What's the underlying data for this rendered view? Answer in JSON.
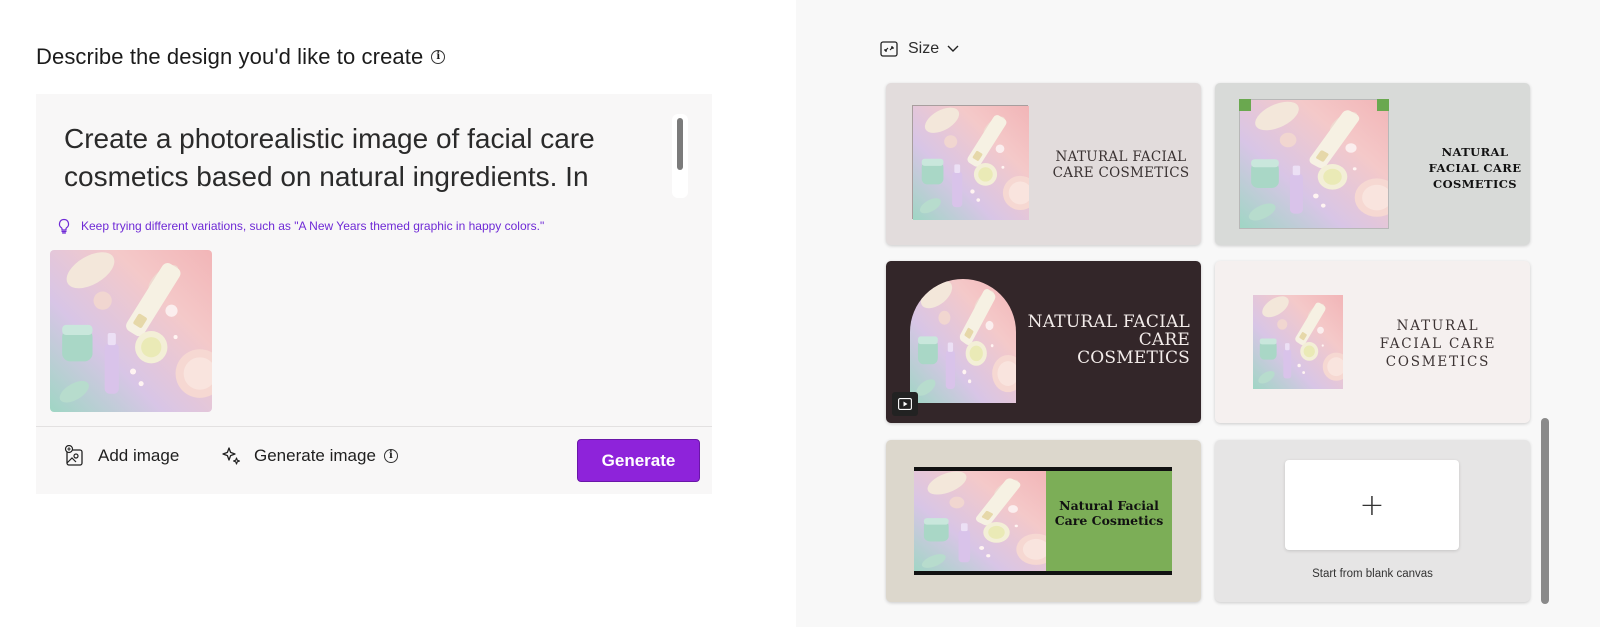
{
  "left": {
    "heading": "Describe the design you'd like to create",
    "prompt": "Create a photorealistic image of facial care cosmetics based on natural ingredients. In",
    "tip": "Keep trying different variations, such as \"A New Years themed graphic in happy colors.\"",
    "actions": {
      "add_image": "Add image",
      "generate_image": "Generate image",
      "generate": "Generate"
    }
  },
  "right": {
    "size_label": "Size",
    "templates": [
      {
        "text": "NATURAL FACIAL CARE COSMETICS"
      },
      {
        "text": "NATURAL FACIAL CARE COSMETICS"
      },
      {
        "text": "NATURAL FACIAL CARE COSMETICS"
      },
      {
        "text": "NATURAL FACIAL CARE COSMETICS"
      },
      {
        "text": "Natural Facial Care Cosmetics"
      }
    ],
    "blank_canvas_label": "Start from blank canvas",
    "blank_canvas_icon": "+"
  },
  "colors": {
    "accent": "#8e23da",
    "tip_text": "#6f2ad6"
  }
}
